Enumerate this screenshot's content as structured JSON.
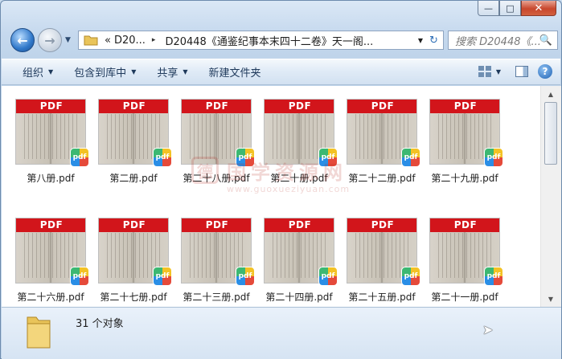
{
  "window": {
    "caption": {
      "minimize": "—",
      "maximize": "□",
      "close": "✕"
    }
  },
  "nav": {
    "back_icon": "arrow-left-icon",
    "forward_icon": "arrow-right-icon",
    "back_glyph": "←",
    "forward_glyph": "→",
    "history_glyph": "▼"
  },
  "address": {
    "prefix": "«",
    "segments": [
      "D20...",
      "D20448《通鉴纪事本末四十二卷》天一阁..."
    ],
    "separator": "▸",
    "dropdown": "▼",
    "refresh_glyph": "↻"
  },
  "search": {
    "placeholder": "搜索 D20448《...",
    "icon": "🔍"
  },
  "toolbar": {
    "organize": "组织",
    "include_library": "包含到库中",
    "share": "共享",
    "new_folder": "新建文件夹",
    "arrow": "▼",
    "help": "?"
  },
  "files": [
    {
      "name": "第八册.pdf",
      "band": "PDF",
      "badge": "pdf"
    },
    {
      "name": "第二册.pdf",
      "band": "PDF",
      "badge": "pdf"
    },
    {
      "name": "第二十八册.pdf",
      "band": "PDF",
      "badge": "pdf"
    },
    {
      "name": "第二十册.pdf",
      "band": "PDF",
      "badge": "pdf"
    },
    {
      "name": "第二十二册.pdf",
      "band": "PDF",
      "badge": "pdf"
    },
    {
      "name": "第二十九册.pdf",
      "band": "PDF",
      "badge": "pdf"
    },
    {
      "name": "第二十六册.pdf",
      "band": "PDF",
      "badge": "pdf"
    },
    {
      "name": "第二十七册.pdf",
      "band": "PDF",
      "badge": "pdf"
    },
    {
      "name": "第二十三册.pdf",
      "band": "PDF",
      "badge": "pdf"
    },
    {
      "name": "第二十四册.pdf",
      "band": "PDF",
      "badge": "pdf"
    },
    {
      "name": "第二十五册.pdf",
      "band": "PDF",
      "badge": "pdf"
    },
    {
      "name": "第二十一册.pdf",
      "band": "PDF",
      "badge": "pdf"
    }
  ],
  "watermark": {
    "logo": "德",
    "title": "国学资源网",
    "url": "www.guoxueziyuan.com"
  },
  "scrollbar": {
    "up": "▲",
    "down": "▼"
  },
  "status": {
    "count": "31 个对象"
  },
  "cursor": "➤"
}
